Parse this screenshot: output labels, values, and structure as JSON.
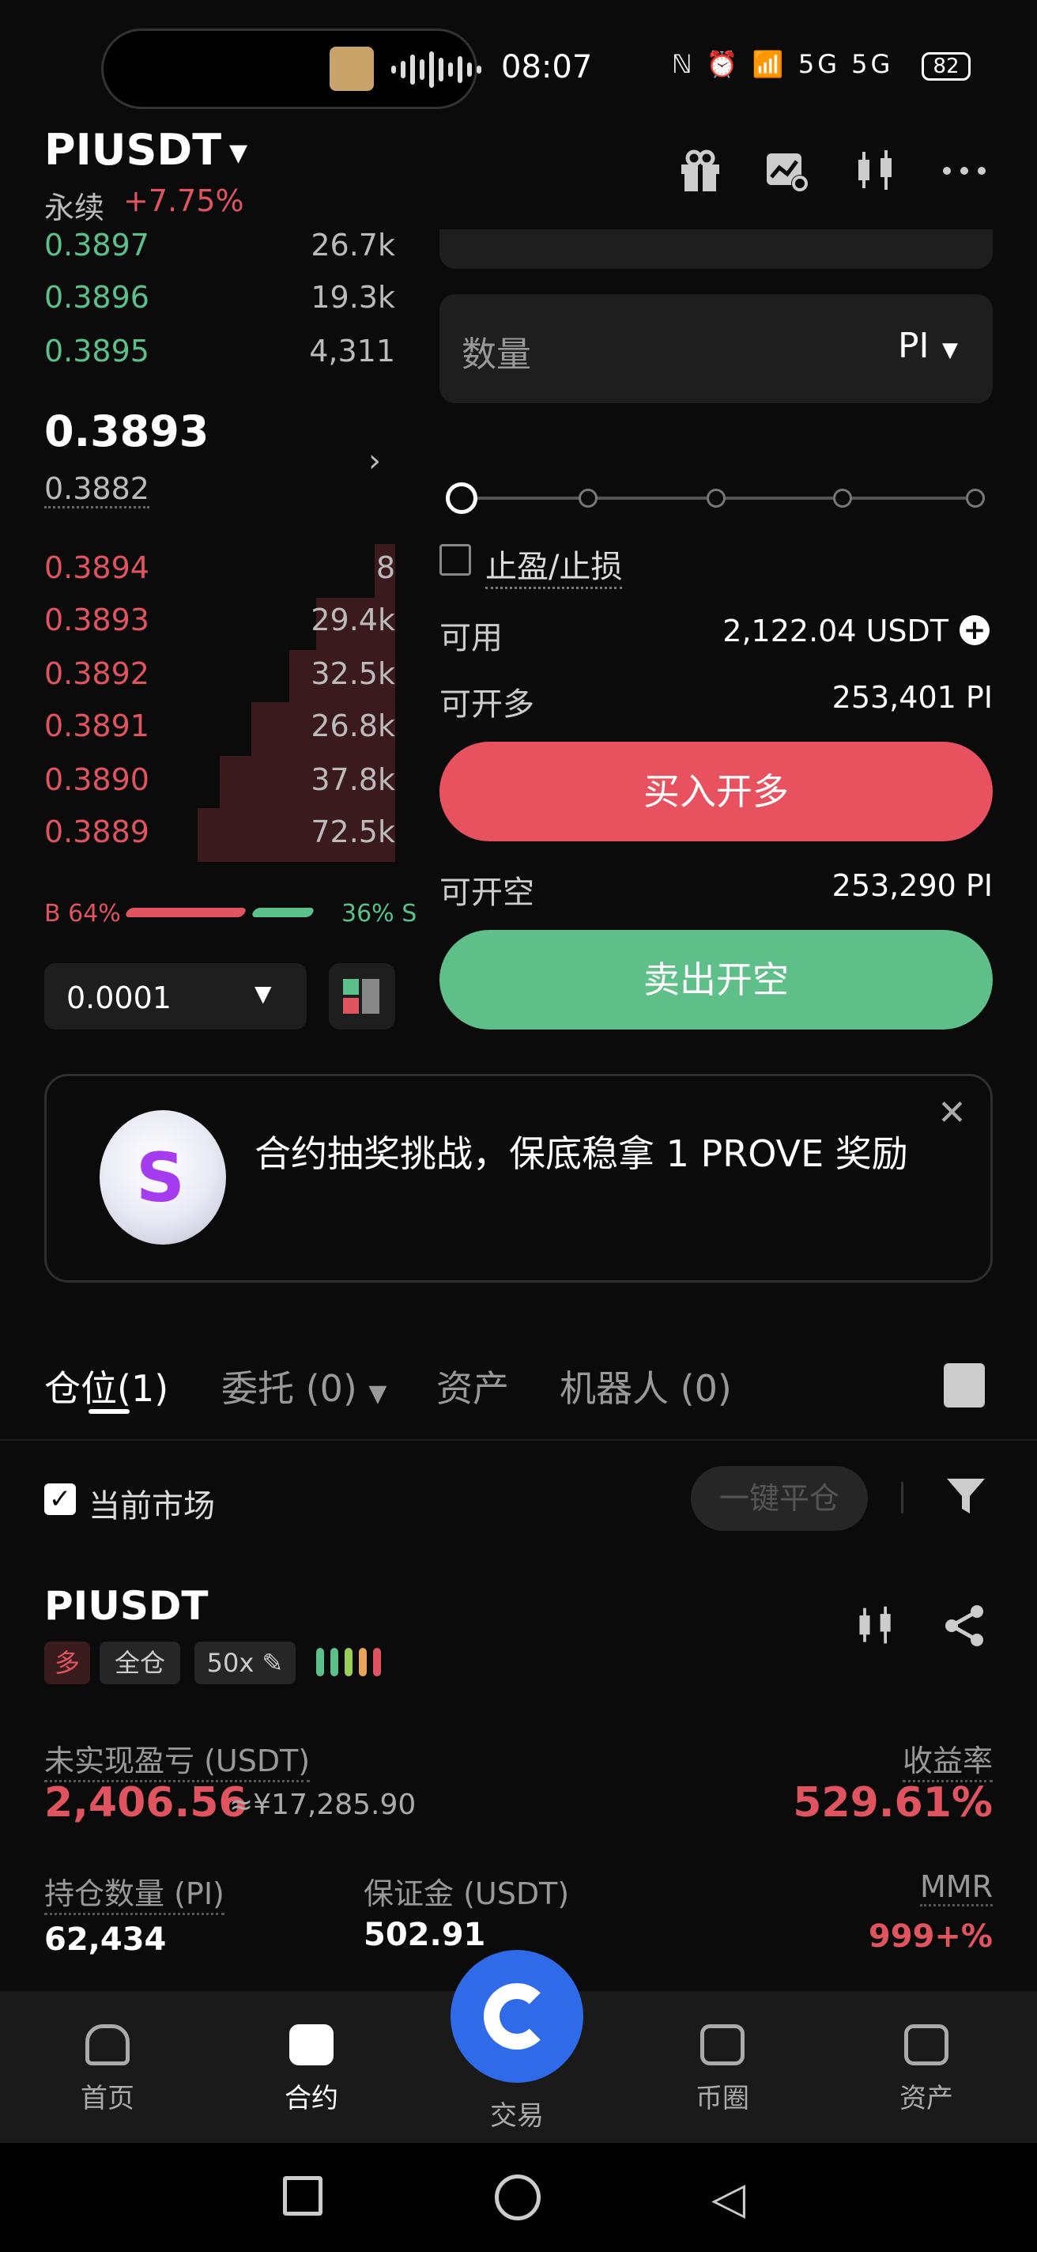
{
  "status_bar": {
    "time": "08:07",
    "battery": "82",
    "signal_text": "ℕ ⏰ 📶 5G 5G"
  },
  "header": {
    "pair": "PIUSDT",
    "type": "永续",
    "change": "+7.75%"
  },
  "orderbook": {
    "bids_top": [
      {
        "price": "0.3897",
        "qty": "26.7k"
      },
      {
        "price": "0.3896",
        "qty": "19.3k"
      },
      {
        "price": "0.3895",
        "qty": "4,311"
      }
    ],
    "last_price": "0.3893",
    "mark_price": "0.3882",
    "asks": [
      {
        "price": "0.3894",
        "qty": "8"
      },
      {
        "price": "0.3893",
        "qty": "29.4k"
      },
      {
        "price": "0.3892",
        "qty": "32.5k"
      },
      {
        "price": "0.3891",
        "qty": "26.8k"
      },
      {
        "price": "0.3890",
        "qty": "37.8k"
      },
      {
        "price": "0.3889",
        "qty": "72.5k"
      }
    ],
    "buy_ratio": "B 64%",
    "sell_ratio": "36% S",
    "step": "0.0001"
  },
  "order_form": {
    "qty_label": "数量",
    "qty_unit": "PI",
    "tp_sl_label": "止盈/止损",
    "available_label": "可用",
    "available_value": "2,122.04 USDT",
    "can_long_label": "可开多",
    "can_long_value": "253,401 PI",
    "buy_label": "买入开多",
    "can_short_label": "可开空",
    "can_short_value": "253,290 PI",
    "sell_label": "卖出开空",
    "slider_value": 0
  },
  "promo": {
    "text": "合约抽奖挑战，保底稳拿 1 PROVE 奖励"
  },
  "tabs": [
    {
      "label": "仓位",
      "count": "(1)"
    },
    {
      "label": "委托 (0)"
    },
    {
      "label": "资产"
    },
    {
      "label": "机器人 (0)"
    }
  ],
  "filter": {
    "current_market": "当前市场",
    "close_all": "一键平仓"
  },
  "position": {
    "pair": "PIUSDT",
    "side": "多",
    "margin_mode": "全仓",
    "leverage": "50x",
    "pnl_label": "未实现盈亏 (USDT)",
    "pnl": "2,406.56",
    "pnl_cny": "≈¥17,285.90",
    "roe_label": "收益率",
    "roe": "529.61%",
    "size_label": "持仓数量 (PI)",
    "size": "62,434",
    "margin_label": "保证金 (USDT)",
    "margin": "502.91",
    "mmr_label": "MMR",
    "mmr": "999+%"
  },
  "bottom_nav": [
    {
      "label": "首页"
    },
    {
      "label": "合约"
    },
    {
      "label": "交易"
    },
    {
      "label": "币圈"
    },
    {
      "label": "资产"
    }
  ],
  "colors": {
    "red": "#e0545f",
    "green": "#5cc08a",
    "brand_blue": "#2f6be8"
  }
}
